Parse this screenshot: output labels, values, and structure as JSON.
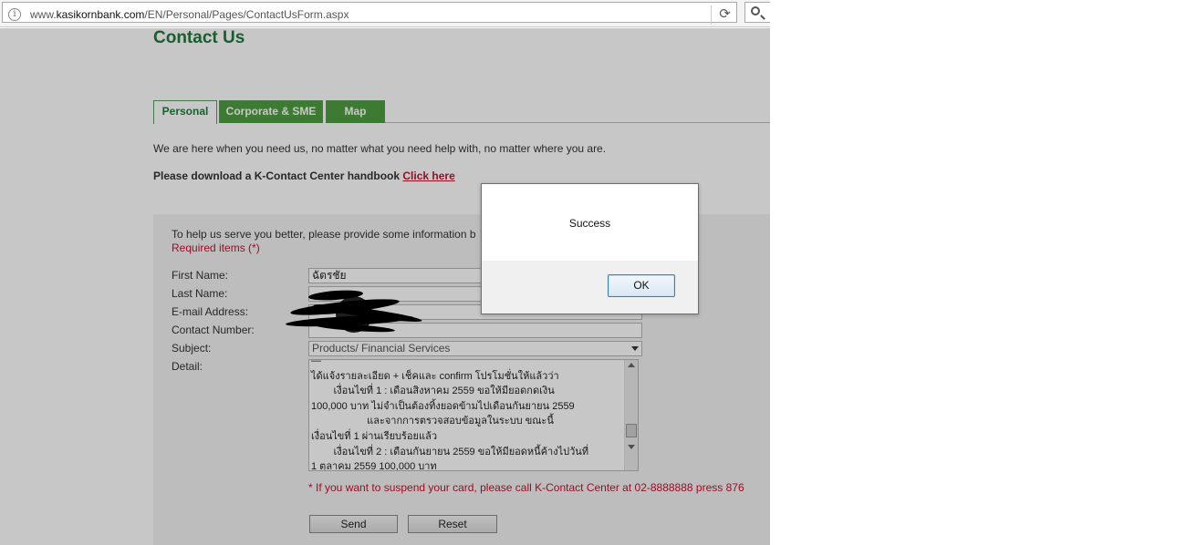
{
  "browser": {
    "url_prefix": "www.",
    "url_domain": "kasikornbank.com",
    "url_path": "/EN/Personal/Pages/ContactUsForm.aspx",
    "info_glyph": "i",
    "reload_glyph": "⟳"
  },
  "page": {
    "title": "Contact Us",
    "tabs": [
      {
        "label": "Personal",
        "active": true
      },
      {
        "label": "Corporate & SME",
        "active": false
      },
      {
        "label": "Map",
        "active": false
      }
    ],
    "intro": "We are here when you need us, no matter what you need help with, no matter where you are.",
    "handbook_text": "Please download a K-Contact Center handbook ",
    "handbook_link": "Click here"
  },
  "form": {
    "help_text": "To help us serve you better, please provide some information b",
    "required_text": "Required items (*)",
    "labels": {
      "first_name": "First Name:",
      "last_name": "Last Name:",
      "email": "E-mail Address:",
      "contact_number": "Contact Number:",
      "subject": "Subject:",
      "detail": "Detail:"
    },
    "values": {
      "first_name": "ฉัตรชัย",
      "last_name": "",
      "email": "",
      "contact_number": ""
    },
    "subject_selected": "Products/ Financial Services",
    "detail_lines": [
      "ได้แจ้งรายละเอียด + เช็คและ confirm โปรโมชั่นให้แล้วว่า",
      "        เงื่อนไขที่ 1 : เดือนสิงหาคม 2559 ขอให้มียอดกดเงิน",
      "100,000 บาท ไม่จำเป็นต้องทิ้งยอดข้ามไปเดือนกันยายน 2559",
      "                    และจากการตรวจสอบข้อมูลในระบบ ขณะนี้",
      "เงื่อนไขที่ 1 ผ่านเรียบร้อยแล้ว",
      "        เงื่อนไขที่ 2 : เดือนกันยายน 2559 ขอให้มียอดหนี้ค้างไปวันที่",
      "1 ตุลาคม 2559 100,000 บาท"
    ],
    "suspend_note": "* If you want to suspend your card, please call K-Contact Center at 02-8888888 press 876",
    "send_label": "Send",
    "reset_label": "Reset"
  },
  "dialog": {
    "message": "Success",
    "ok_label": "OK"
  }
}
